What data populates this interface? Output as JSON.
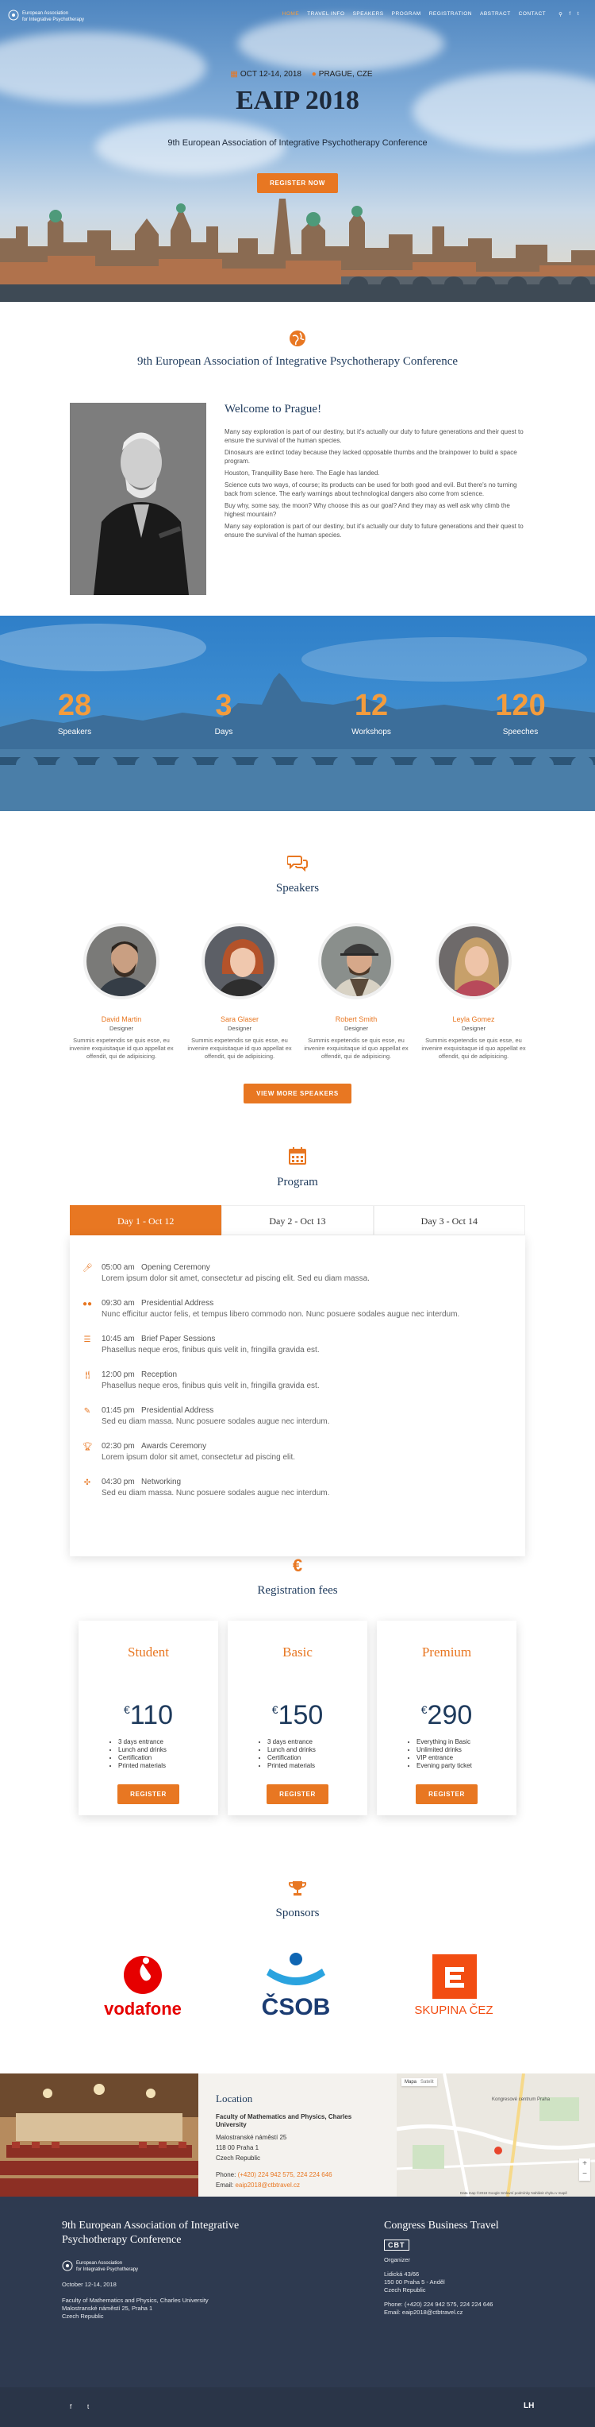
{
  "nav": {
    "logo_line1": "European Association",
    "logo_line2": "for Integrative Psychotherapy",
    "links": [
      "HOME",
      "TRAVEL INFO",
      "SPEAKERS",
      "PROGRAM",
      "REGISTRATION",
      "ABSTRACT",
      "CONTACT"
    ]
  },
  "hero": {
    "date": "OCT 12-14, 2018",
    "place": "PRAGUE, CZE",
    "title": "EAIP 2018",
    "subtitle": "9th European Association of Integrative Psychotherapy Conference",
    "cta": "REGISTER NOW"
  },
  "about": {
    "heading": "9th European Association of Integrative Psychotherapy Conference",
    "welcome": "Welcome to Prague!",
    "paragraphs": [
      "Many say exploration is part of our destiny, but it's actually our duty to future generations and their quest to ensure the survival of the human species.",
      "Dinosaurs are extinct today because they lacked opposable thumbs and the brainpower to build a space program.",
      "Houston, Tranquillity Base here. The Eagle has landed.",
      "Science cuts two ways, of course; its products can be used for both good and evil. But there's no turning back from science. The early warnings about technological dangers also come from science.",
      "Buy why, some say, the moon? Why choose this as our goal? And they may as well ask why climb the highest mountain?",
      "Many say exploration is part of our destiny, but it's actually our duty to future generations and their quest to ensure the survival of the human species."
    ]
  },
  "stats": [
    {
      "num": "28",
      "label": "Speakers"
    },
    {
      "num": "3",
      "label": "Days"
    },
    {
      "num": "12",
      "label": "Workshops"
    },
    {
      "num": "120",
      "label": "Speeches"
    }
  ],
  "speakers": {
    "heading": "Speakers",
    "items": [
      {
        "name": "David Martin",
        "role": "Designer",
        "desc": "Summis expetendis se quis esse, eu invenire exquisitaque id quo appellat ex offendit, qui de adipisicing."
      },
      {
        "name": "Sara Glaser",
        "role": "Designer",
        "desc": "Summis expetendis se quis esse, eu invenire exquisitaque id quo appellat ex offendit, qui de adipisicing."
      },
      {
        "name": "Robert Smith",
        "role": "Designer",
        "desc": "Summis expetendis se quis esse, eu invenire exquisitaque id quo appellat ex offendit, qui de adipisicing."
      },
      {
        "name": "Leyla Gomez",
        "role": "Designer",
        "desc": "Summis expetendis se quis esse, eu invenire exquisitaque id quo appellat ex offendit, qui de adipisicing."
      }
    ],
    "more": "VIEW MORE SPEAKERS"
  },
  "program": {
    "heading": "Program",
    "tabs": [
      "Day 1 - Oct 12",
      "Day 2 - Oct 13",
      "Day 3 - Oct 14"
    ],
    "items": [
      {
        "time": "05:00 am",
        "title": "Opening Ceremony",
        "desc": "Lorem ipsum dolor sit amet, consectetur ad piscing elit. Sed eu diam massa."
      },
      {
        "time": "09:30 am",
        "title": "Presidential Address",
        "desc": "Nunc efficitur auctor felis, et tempus libero commodo non. Nunc posuere sodales augue nec interdum."
      },
      {
        "time": "10:45 am",
        "title": "Brief Paper Sessions",
        "desc": "Phasellus neque eros, finibus quis velit in, fringilla gravida est."
      },
      {
        "time": "12:00 pm",
        "title": "Reception",
        "desc": "Phasellus neque eros, finibus quis velit in, fringilla gravida est."
      },
      {
        "time": "01:45 pm",
        "title": "Presidential Address",
        "desc": "Sed eu diam massa. Nunc posuere sodales augue nec interdum."
      },
      {
        "time": "02:30 pm",
        "title": "Awards Ceremony",
        "desc": "Lorem ipsum dolor sit amet, consectetur ad piscing elit."
      },
      {
        "time": "04:30 pm",
        "title": "Networking",
        "desc": "Sed eu diam massa. Nunc posuere sodales augue nec interdum."
      }
    ]
  },
  "pricing": {
    "heading": "Registration fees",
    "plans": [
      {
        "name": "Student",
        "currency": "€",
        "price": "110",
        "features": [
          "3 days entrance",
          "Lunch and drinks",
          "Certification",
          "Printed materials"
        ],
        "button": "REGISTER"
      },
      {
        "name": "Basic",
        "currency": "€",
        "price": "150",
        "features": [
          "3 days entrance",
          "Lunch and drinks",
          "Certification",
          "Printed materials"
        ],
        "button": "REGISTER"
      },
      {
        "name": "Premium",
        "currency": "€",
        "price": "290",
        "features": [
          "Everything in Basic",
          "Unlimited drinks",
          "VIP entrance",
          "Evening party ticket"
        ],
        "button": "REGISTER"
      }
    ]
  },
  "sponsors": {
    "heading": "Sponsors",
    "items": [
      "vodafone",
      "ČSOB",
      "SKUPINA ČEZ"
    ]
  },
  "location": {
    "heading": "Location",
    "venue": "Faculty of Mathematics and Physics, Charles University",
    "lines": [
      "Malostranské náměstí 25",
      "118 00 Praha 1",
      "Czech Republic"
    ],
    "phone_label": "Phone:",
    "phone": "(+420) 224 942 575, 224 224 646",
    "email_label": "Email:",
    "email": "eaip2018@ctbtravel.cz",
    "map_tabs": [
      "Mapa",
      "Satelit"
    ],
    "map_place": "Kongresové centrum Praha",
    "map_footer": "Data map ©2018 Google   Smluvní podmínky   Nahlásit chybu v mapě"
  },
  "footer": {
    "title": "9th European Association of Integrative Psychotherapy Conference",
    "logo_line1": "European Association",
    "logo_line2": "for Integrative Psychotherapy",
    "date": "October 12-14, 2018",
    "venue_lines": [
      "Faculty of Mathematics and Physics, Charles University",
      "Malostranské náměstí 25, Praha 1",
      "Czech Republic"
    ],
    "org_title": "Congress Business Travel",
    "org_logo": "CBT",
    "org_label": "Organizer",
    "org_lines": [
      "Lidická 43/66",
      "150 00 Praha 5 - Anděl",
      "Czech Republic"
    ],
    "org_contact": [
      "Phone: (+420) 224 942 575, 224 224 646",
      "Email: eaip2018@ctbtravel.cz"
    ],
    "bottom_badge": "LH"
  },
  "colors": {
    "accent": "#e87722",
    "navy": "#1e3a5c",
    "footer": "#2e3a50"
  }
}
